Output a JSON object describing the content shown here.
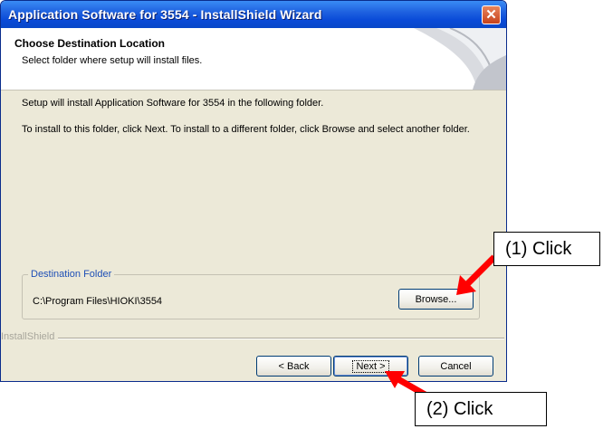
{
  "window": {
    "title": "Application Software for 3554 - InstallShield Wizard",
    "close_glyph": "✕"
  },
  "header": {
    "title": "Choose Destination Location",
    "subtitle": "Select folder where setup will install files."
  },
  "body": {
    "line1": "Setup will install Application Software for 3554 in the following folder.",
    "line2": "To install to this folder, click Next. To install to a different folder, click Browse and select another folder."
  },
  "destination": {
    "group_label": "Destination Folder",
    "path": "C:\\Program Files\\HIOKI\\3554",
    "browse_label": "Browse..."
  },
  "footer": {
    "brand": "InstallShield",
    "back_label": "< Back",
    "next_label": "Next >",
    "cancel_label": "Cancel"
  },
  "annotations": {
    "callout1": "(1) Click",
    "callout2": "(2) Click",
    "arrow_color": "#ff0000"
  },
  "icons": [
    "close-icon",
    "installer-art-icon",
    "callout-arrow-icon"
  ]
}
